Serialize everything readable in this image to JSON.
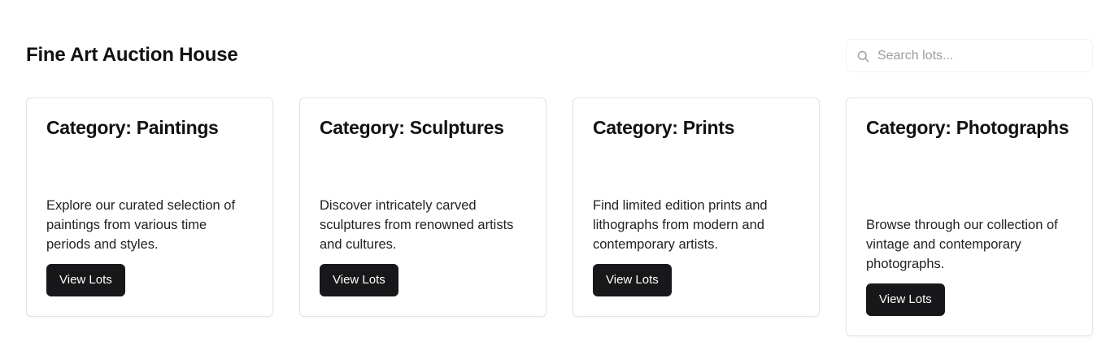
{
  "header": {
    "title": "Fine Art Auction House"
  },
  "search": {
    "placeholder": "Search lots...",
    "value": "",
    "icon": "search-icon"
  },
  "categories": [
    {
      "title": "Category: Paintings",
      "description": "Explore our curated selection of paintings from various time periods and styles.",
      "button_label": "View Lots"
    },
    {
      "title": "Category: Sculptures",
      "description": "Discover intricately carved sculptures from renowned artists and cultures.",
      "button_label": "View Lots"
    },
    {
      "title": "Category: Prints",
      "description": "Find limited edition prints and lithographs from modern and contemporary artists.",
      "button_label": "View Lots"
    },
    {
      "title": "Category: Photographs",
      "description": "Browse through our collection of vintage and contemporary photographs.",
      "button_label": "View Lots"
    }
  ],
  "colors": {
    "button_bg": "#18181b",
    "button_text": "#ffffff",
    "card_border": "#e4e4e7",
    "placeholder": "#9a9ca3"
  }
}
